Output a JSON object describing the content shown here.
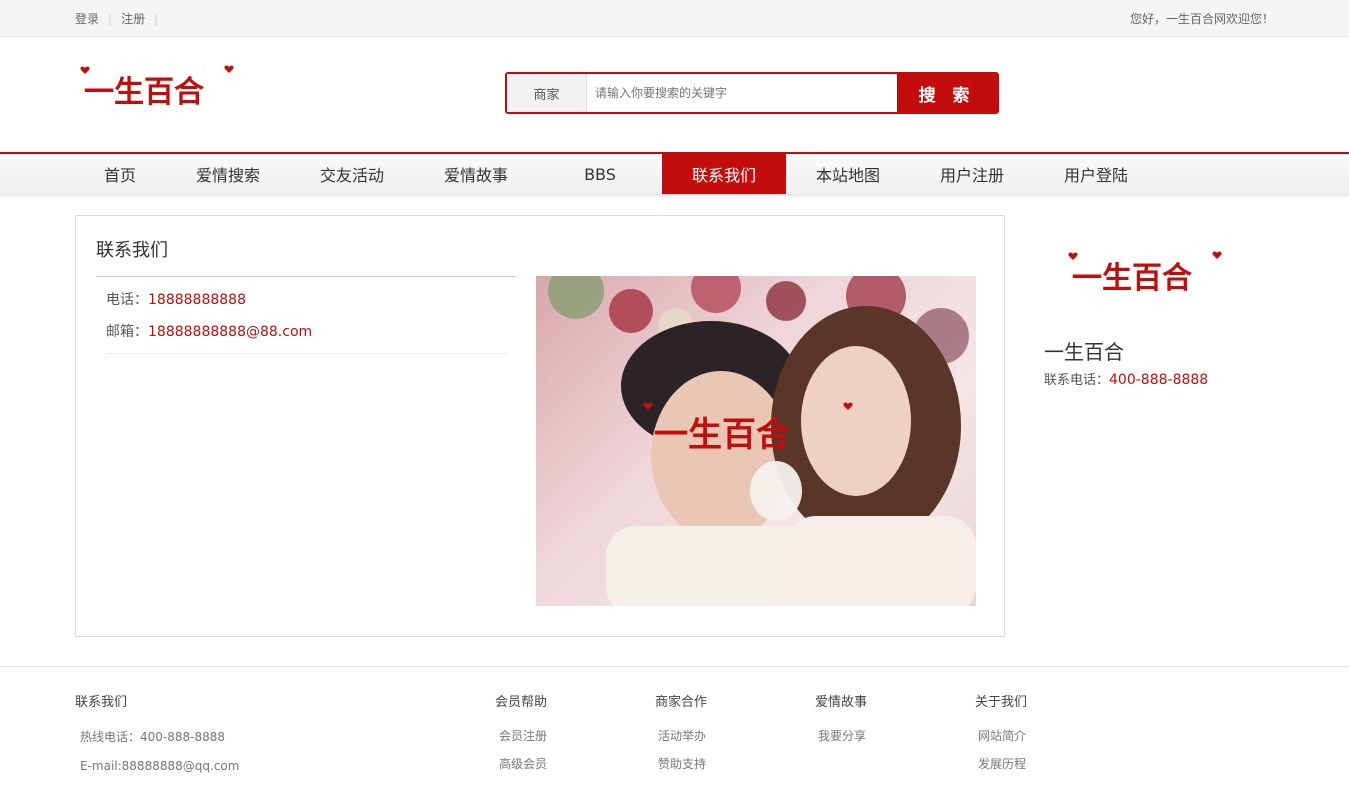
{
  "topbar": {
    "login": "登录",
    "register": "注册",
    "welcome": "您好，一生百合网欢迎您！"
  },
  "logo": {
    "text": "一生百合"
  },
  "search": {
    "category": "商家",
    "placeholder": "请输入你要搜索的关键字",
    "button": "搜 索"
  },
  "nav": {
    "items": [
      "首页",
      "爱情搜索",
      "交友活动",
      "爱情故事",
      "BBS",
      "联系我们",
      "本站地图",
      "用户注册",
      "用户登陆"
    ],
    "active_index": 5
  },
  "main": {
    "title": "联系我们",
    "phone_label": "电话：",
    "phone": "18888888888",
    "email_label": "邮箱：",
    "email": "18888888888@88.com"
  },
  "side": {
    "name": "一生百合",
    "tel_label": "联系电话：",
    "tel": "400-888-8888"
  },
  "footer": {
    "contact": {
      "title": "联系我们",
      "hotline": "热线电话：400-888-8888",
      "email": "E-mail:88888888@qq.com"
    },
    "cols": [
      {
        "title": "会员帮助",
        "items": [
          "会员注册",
          "高级会员"
        ]
      },
      {
        "title": "商家合作",
        "items": [
          "活动举办",
          "赞助支持"
        ]
      },
      {
        "title": "爱情故事",
        "items": [
          "我要分享"
        ]
      },
      {
        "title": "关于我们",
        "items": [
          "网站简介",
          "发展历程"
        ]
      }
    ]
  },
  "colors": {
    "brand": "#c30d0d"
  }
}
